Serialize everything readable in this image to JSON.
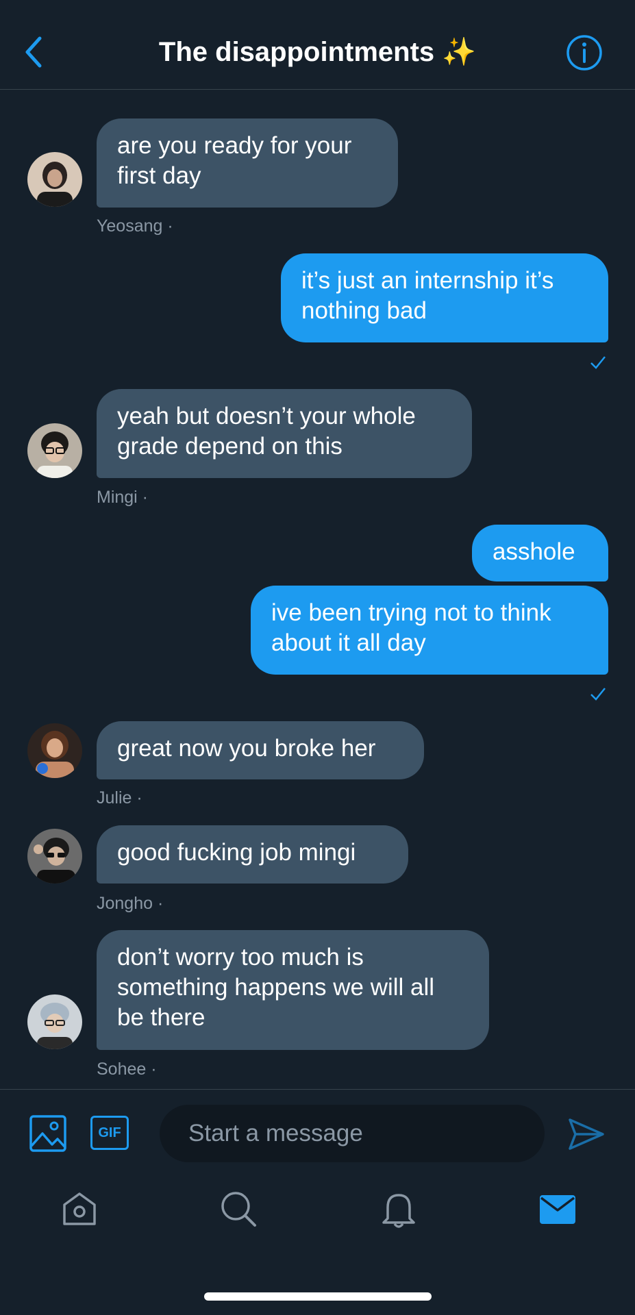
{
  "header": {
    "title": "The disappointments ✨"
  },
  "messages": [
    {
      "direction": "in",
      "sender": "Yeosang ·",
      "lines": [
        "are you ready for your",
        "first day"
      ]
    },
    {
      "direction": "out",
      "lines": [
        "it’s just an internship it’s",
        "nothing bad"
      ]
    },
    {
      "direction": "in",
      "sender": "Mingi ·",
      "lines": [
        "yeah but doesn’t your whole",
        "grade depend on this"
      ]
    },
    {
      "direction": "out",
      "lines": [
        "asshole"
      ]
    },
    {
      "direction": "out",
      "lines": [
        "ive been trying not to think",
        "about it all day"
      ]
    },
    {
      "direction": "in",
      "sender": "Julie ·",
      "lines": [
        "great now you broke her"
      ]
    },
    {
      "direction": "in",
      "sender": "Jongho ·",
      "lines": [
        "good fucking job mingi"
      ]
    },
    {
      "direction": "in",
      "sender": "Sohee ·",
      "lines": [
        "don’t worry too much is",
        "something happens we will all",
        "be there"
      ]
    }
  ],
  "composer": {
    "gif_label": "GIF",
    "placeholder": "Start a message"
  },
  "tabbar": {
    "items": [
      "home-icon",
      "search-icon",
      "bell-icon",
      "mail-icon"
    ]
  },
  "colors": {
    "background": "#15202b",
    "incoming_bubble": "#3d5366",
    "outgoing_bubble": "#1d9bf0",
    "accent": "#1d9bf0",
    "secondary_text": "#8b98a5"
  }
}
